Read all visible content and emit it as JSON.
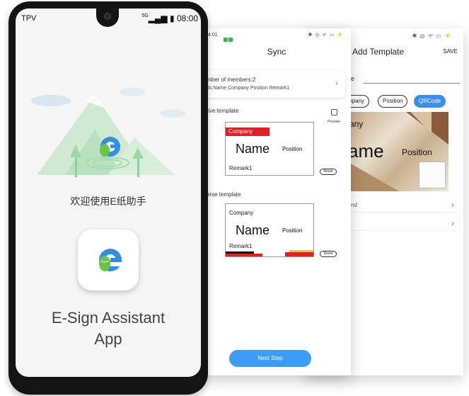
{
  "phone": {
    "carrier": "TPV",
    "network": "5G",
    "time": "08:00",
    "welcome_text": "欢迎使用E纸助手",
    "app_name_line1": "E-Sign Assistant",
    "app_name_line2": "App"
  },
  "sync_screen": {
    "status_time": "4:01",
    "title": "Sync",
    "members_label": "mber of members:2",
    "fields_label": "ds:Name Company Position Remark1",
    "positive_label": "tive template",
    "preview_label": "Preview",
    "reverse_label": "erse template",
    "card1": {
      "company": "Company",
      "name": "Name",
      "position": "Position",
      "remark": "Remark1"
    },
    "card2": {
      "company": "Company",
      "name": "Name",
      "position": "Position",
      "remark": "Remark1"
    },
    "reset_label": "Reset",
    "next_button": "Next Step"
  },
  "template_screen": {
    "title": "Add Template",
    "save_label": "SAVE",
    "name_label": "e",
    "chips": [
      "mpany",
      "Position",
      "QRCode"
    ],
    "preview_company": "any",
    "preview_name": "ame",
    "preview_position": "Position",
    "row1_label": "nd"
  },
  "colors": {
    "accent": "#3d8cf0",
    "button": "#3d9cf4",
    "red": "#e21f26"
  }
}
